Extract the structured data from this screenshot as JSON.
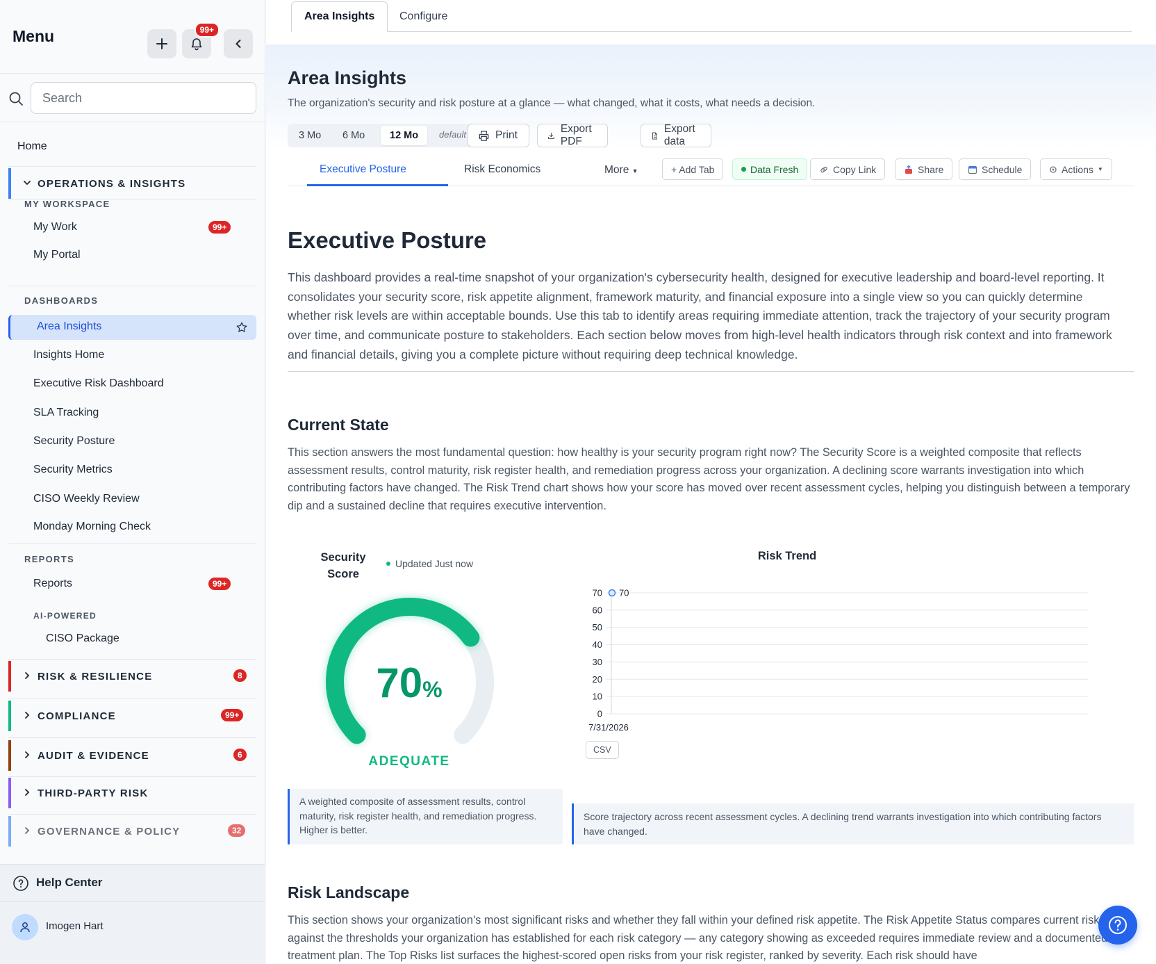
{
  "sidebar": {
    "title": "Menu",
    "notif_badge": "99+",
    "search_placeholder": "Search",
    "home": "Home",
    "ops_group": "OPERATIONS & INSIGHTS",
    "my_workspace": "MY WORKSPACE",
    "my_work": "My Work",
    "my_work_badge": "99+",
    "my_portal": "My Portal",
    "dashboards": "DASHBOARDS",
    "dashboard_items": [
      "Insights Home",
      "Executive Risk Dashboard",
      "SLA Tracking",
      "Security Posture",
      "Security Metrics",
      "CISO Weekly Review",
      "Monday Morning Check"
    ],
    "active_item": "Area Insights",
    "reports_section": "REPORTS",
    "reports": "Reports",
    "reports_badge": "99+",
    "ai_powered": "AI-POWERED",
    "ciso_package": "CISO Package",
    "groups": [
      {
        "label": "RISK & RESILIENCE",
        "badge": "8",
        "color": "#dc2626"
      },
      {
        "label": "COMPLIANCE",
        "badge": "99+",
        "color": "#10b981"
      },
      {
        "label": "AUDIT & EVIDENCE",
        "badge": "6",
        "color": "#92400e"
      },
      {
        "label": "THIRD-PARTY RISK",
        "badge": "",
        "color": "#8b5cf6"
      },
      {
        "label": "GOVERNANCE & POLICY",
        "badge": "32",
        "color": "#3b82f6"
      }
    ],
    "ops_color": "#3b82f6",
    "help": "Help Center",
    "user": "Imogen Hart"
  },
  "top_tabs": [
    "Area Insights",
    "Configure"
  ],
  "header": {
    "title": "Area Insights",
    "subtitle": "The organization's security and risk posture at a glance — what changed, what it costs, what needs a decision."
  },
  "toolbar": {
    "ranges": [
      "3 Mo",
      "6 Mo",
      "12 Mo"
    ],
    "selected_range": "12 Mo",
    "default_label": "default",
    "print": "Print",
    "export_pdf": "Export PDF",
    "export_data": "Export data"
  },
  "dash_tabs": {
    "tabs": [
      "Executive Posture",
      "Risk Economics"
    ],
    "more": "More",
    "add_tab": "+ Add Tab",
    "data_fresh": "Data Fresh",
    "copy_link": "Copy Link",
    "share": "Share",
    "schedule": "Schedule",
    "actions": "Actions"
  },
  "executive": {
    "title": "Executive Posture",
    "body": "This dashboard provides a real-time snapshot of your organization's cybersecurity health, designed for executive leadership and board-level reporting. It consolidates your security score, risk appetite alignment, framework maturity, and financial exposure into a single view so you can quickly determine whether risk levels are within acceptable bounds. Use this tab to identify areas requiring immediate attention, track the trajectory of your security program over time, and communicate posture to stakeholders. Each section below moves from high-level health indicators through risk context and into framework and financial details, giving you a complete picture without requiring deep technical knowledge."
  },
  "current_state": {
    "title": "Current State",
    "body": "This section answers the most fundamental question: how healthy is your security program right now? The Security Score is a weighted composite that reflects assessment results, control maturity, risk register health, and remediation progress across your organization. A declining score warrants investigation into which contributing factors have changed. The Risk Trend chart shows how your score has moved over recent assessment cycles, helping you distinguish between a temporary dip and a sustained decline that requires executive intervention."
  },
  "score": {
    "title": "Security Score",
    "updated": "Updated Just now",
    "value": 70,
    "value_text": "70",
    "unit": "%",
    "label": "ADEQUATE",
    "note": "A weighted composite of assessment results, control maturity, risk register health, and remediation progress. Higher is better.",
    "color": "#10b981"
  },
  "chart_data": {
    "type": "line",
    "title": "Risk Trend",
    "x": [
      "7/31/2026"
    ],
    "series": [
      {
        "values": [
          70
        ]
      }
    ],
    "data_labels": [
      "70"
    ],
    "ylim": [
      0,
      70
    ],
    "yticks": [
      0,
      10,
      20,
      30,
      40,
      50,
      60,
      70
    ],
    "xlabel": "",
    "ylabel": "",
    "grid": true
  },
  "trend": {
    "csv": "CSV",
    "note": "Score trajectory across recent assessment cycles. A declining trend warrants investigation into which contributing factors have changed."
  },
  "risk_landscape": {
    "title": "Risk Landscape",
    "body": "This section shows your organization's most significant risks and whether they fall within your defined risk appetite. The Risk Appetite Status compares current risk levels against the thresholds your organization has established for each risk category — any category showing as exceeded requires immediate review and a documented treatment plan. The Top Risks list surfaces the highest-scored open risks from your risk register, ranked by severity. Each risk should have"
  }
}
